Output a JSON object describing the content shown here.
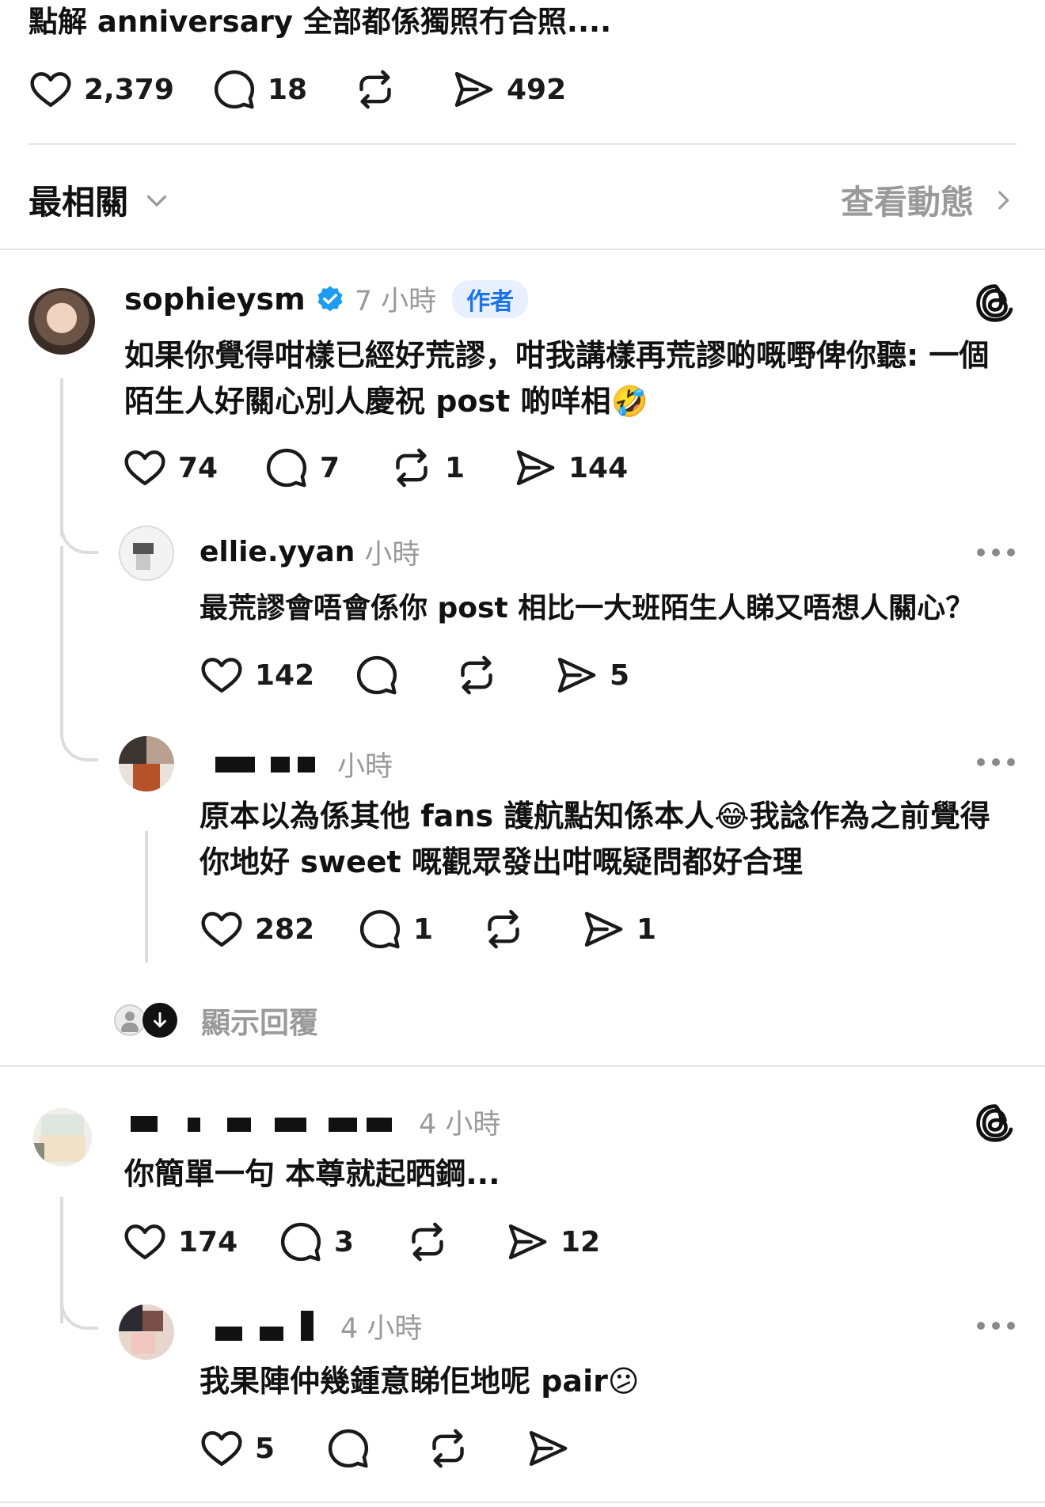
{
  "top_post": {
    "caption": "點解 anniversary 全部都係獨照冇合照....",
    "likes": "2,379",
    "replies": "18",
    "shares": "492"
  },
  "sort": {
    "label": "最相關",
    "activity_link": "查看動態"
  },
  "comments": [
    {
      "username": "sophieysm",
      "verified": true,
      "time": "7 小時",
      "badge": "作者",
      "text_lines": [
        "如果你覺得咁樣已經好荒謬，咁我講樣再荒謬啲嘅嘢俾你聽: 一個",
        "陌生人好關心別人慶祝 post 啲咩相🤣"
      ],
      "likes": "74",
      "replies": "7",
      "reposts": "1",
      "shares": "144",
      "replies_list": [
        {
          "username": "ellie.yyan",
          "time": "小時",
          "text_lines": [
            "最荒謬會唔會係你 post 相比一大班陌生人睇又唔想人關心？"
          ],
          "likes": "142",
          "shares": "5"
        },
        {
          "username": "",
          "time": "小時",
          "text_lines": [
            "原本以為係其他 fans 護航點知係本人😂我諗作為之前覺得",
            "你地好 sweet 嘅觀眾發出咁嘅疑問都好合理"
          ],
          "likes": "282",
          "replies": "1",
          "shares": "1"
        }
      ],
      "show_replies": "顯示回覆"
    },
    {
      "username": "",
      "time": "4 小時",
      "text_lines": [
        "你簡單一句 本尊就起晒鋼..."
      ],
      "likes": "174",
      "replies": "3",
      "shares": "12",
      "replies_list": [
        {
          "username": "",
          "time": "4 小時",
          "text_lines": [
            "我果陣仲幾鍾意睇佢地呢 pair😕"
          ],
          "likes": "5"
        }
      ]
    }
  ],
  "colors": {
    "verified": "#1d9bf0",
    "badge_bg": "#e8f0fd",
    "badge_text": "#1a73e8",
    "muted": "#9a9a9a"
  }
}
